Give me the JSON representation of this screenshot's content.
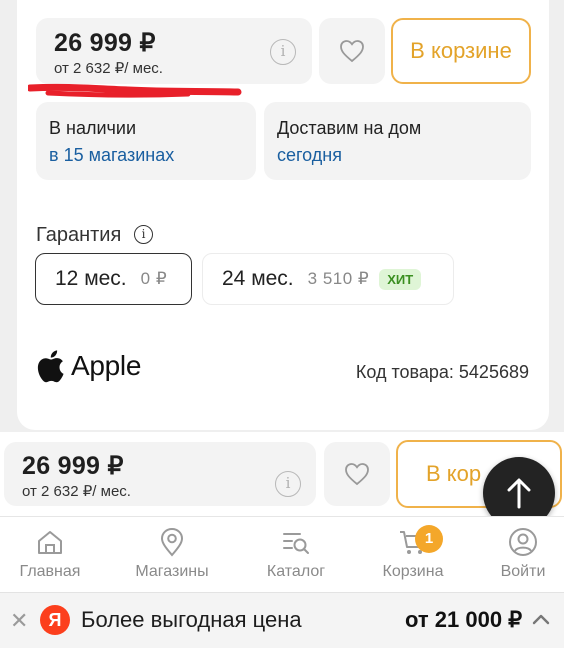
{
  "product": {
    "price": "26 999 ₽",
    "installment": "от 2 632 ₽/ мес.",
    "cart_label": "В корзине"
  },
  "availability": {
    "stock_label": "В наличии",
    "stock_value": "в 15 магазинах",
    "delivery_label": "Доставим на дом",
    "delivery_value": "сегодня"
  },
  "warranty": {
    "title": "Гарантия",
    "options": [
      {
        "term": "12 мес.",
        "price": "0 ₽",
        "selected": true
      },
      {
        "term": "24 мес.",
        "price": "3 510 ₽",
        "badge": "ХИТ",
        "selected": false
      }
    ]
  },
  "brand": {
    "name": "Apple"
  },
  "sku": "Код товара: 5425689",
  "sticky_bar": {
    "price": "26 999 ₽",
    "installment": "от 2 632 ₽/ мес.",
    "cart_label_visible": "В кор"
  },
  "bottom_nav": {
    "items": [
      {
        "label": "Главная",
        "icon": "home-icon"
      },
      {
        "label": "Магазины",
        "icon": "map-pin-icon"
      },
      {
        "label": "Каталог",
        "icon": "catalog-search-icon"
      },
      {
        "label": "Корзина",
        "icon": "cart-icon",
        "badge": "1"
      },
      {
        "label": "Войти",
        "icon": "user-icon"
      }
    ]
  },
  "yandex_banner": {
    "logo": "Я",
    "text": "Более выгодная цена",
    "price": "от 21 000 ₽"
  },
  "colors": {
    "accent_orange": "#f0b24a",
    "link_blue": "#1a5fa0",
    "badge_green_bg": "#dff5d6",
    "badge_green_text": "#3b8f21",
    "yandex_red": "#fc3f1d",
    "annotation_red": "#e8202a"
  }
}
